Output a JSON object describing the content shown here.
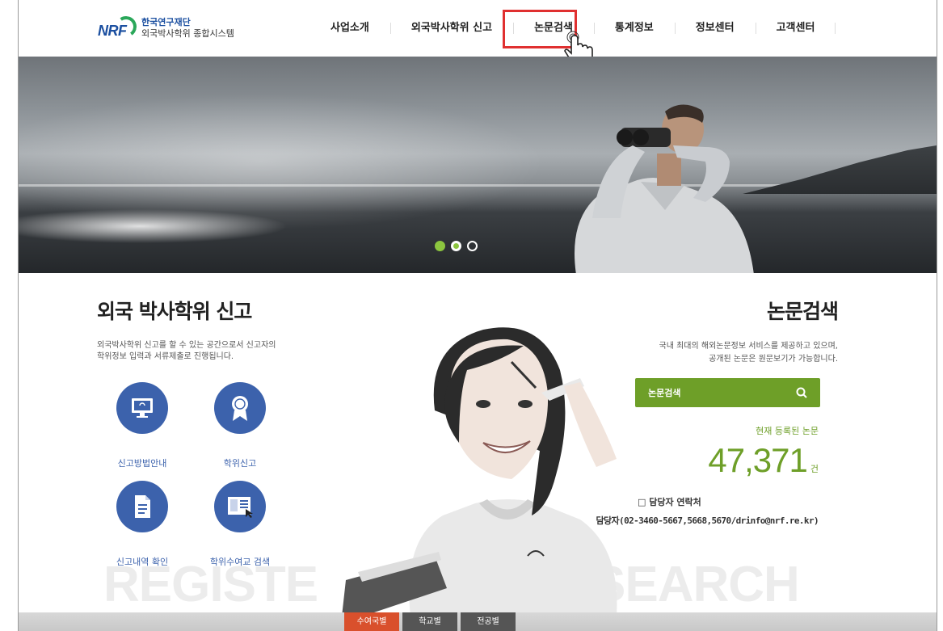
{
  "header": {
    "logo_mark": "NRF",
    "logo_line1": "한국연구재단",
    "logo_line2": "외국박사학위 종합시스템",
    "nav": [
      "사업소개",
      "외국박사학위 신고",
      "논문검색",
      "통계정보",
      "정보센터",
      "고객센터"
    ],
    "highlighted_nav": "논문검색",
    "highlight_color": "#e03030"
  },
  "hero": {
    "slides": 3,
    "active_slide": 1,
    "accent": "#8cc63f"
  },
  "register": {
    "title": "외국 박사학위 신고",
    "desc_line1": "외국박사학위 신고를 할 수 있는 공간으로서 신고자의",
    "desc_line2": "학위정보 입력과 서류제출로 진행됩니다.",
    "buttons": [
      {
        "label": "신고방법안내",
        "icon": "monitor-icon"
      },
      {
        "label": "학위신고",
        "icon": "award-ribbon-icon"
      },
      {
        "label": "신고내역 확인",
        "icon": "document-icon"
      },
      {
        "label": "학위수여교 검색",
        "icon": "search-window-icon"
      }
    ],
    "watermark": "REGISTE",
    "button_color": "#3c62ac"
  },
  "search": {
    "title": "논문검색",
    "desc_line1": "국내 최대의 해외논문정보 서비스를 제공하고 있으며,",
    "desc_line2": "공개된 논문은 원문보기가 가능합니다.",
    "button_label": "논문검색",
    "registered_label": "현재 등록된 논문",
    "count": "47,371",
    "count_unit": "건",
    "contact_title": "□ 담당자 연락처",
    "contact_line": "담당자(02-3460-5667,5668,5670/drinfo@nrf.re.kr)",
    "watermark": "SEARCH",
    "accent": "#6e9f28"
  },
  "bottom_tabs": {
    "items": [
      "수여국별",
      "학교별",
      "전공별"
    ],
    "active": "수여국별",
    "active_color": "#d9502c"
  }
}
